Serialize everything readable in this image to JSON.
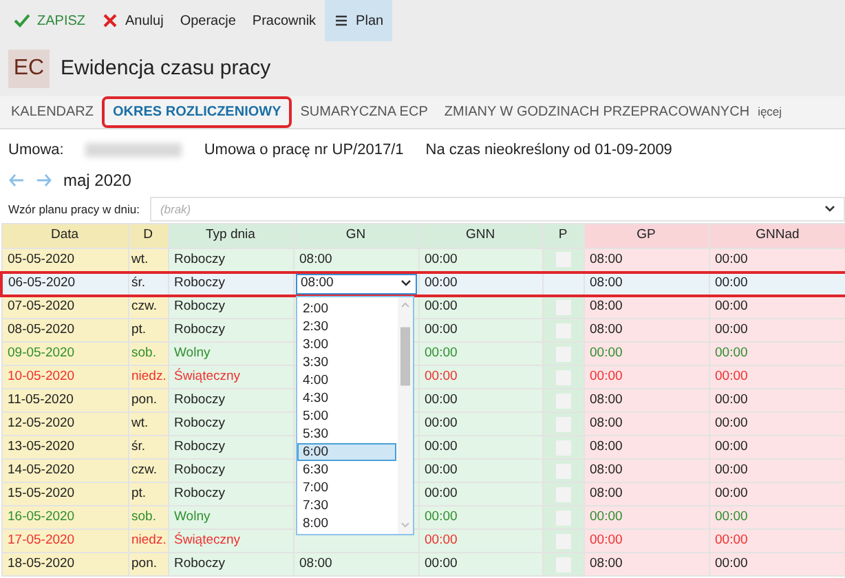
{
  "toolbar": [
    {
      "kind": "check",
      "label": "ZAPISZ",
      "selected": false
    },
    {
      "kind": "cross",
      "label": "Anuluj",
      "selected": false
    },
    {
      "kind": "text",
      "label": "Operacje",
      "selected": false
    },
    {
      "kind": "text",
      "label": "Pracownik",
      "selected": false
    },
    {
      "kind": "menu",
      "label": "Plan",
      "selected": true
    }
  ],
  "header": {
    "badge": "EC",
    "title": "Ewidencja czasu pracy"
  },
  "tabs": [
    {
      "label": "KALENDARZ",
      "selected": false
    },
    {
      "label": "OKRES ROZLICZENIOWY",
      "selected": true
    },
    {
      "label": "SUMARYCZNA ECP",
      "selected": false
    },
    {
      "label": "ZMIANY W GODZINACH PRZEPRACOWANYCH",
      "selected": false
    }
  ],
  "more_tabs": "ięcej",
  "contract": {
    "label": "Umowa:",
    "type": "Umowa o pracę nr UP/2017/1",
    "period": "Na czas nieokreślony od 01-09-2009"
  },
  "month": "maj 2020",
  "plan_pattern": {
    "label": "Wzór planu pracy w dniu:",
    "placeholder": "(brak)"
  },
  "table": {
    "columns": [
      "Data",
      "D",
      "Typ dnia",
      "GN",
      "GNN",
      "P",
      "GP",
      "GNNad"
    ],
    "rows": [
      {
        "date": "05-05-2020",
        "day": "wt.",
        "type": "Roboczy",
        "kind": "work",
        "gn": "08:00",
        "gnn": "00:00",
        "p_checked": false,
        "gp": "08:00",
        "gnnad": "00:00",
        "selected": false
      },
      {
        "date": "06-05-2020",
        "day": "śr.",
        "type": "Roboczy",
        "kind": "work",
        "gn": "08:00",
        "gnn": "00:00",
        "gp": "08:00",
        "gnnad": "00:00",
        "selected": true
      },
      {
        "date": "07-05-2020",
        "day": "czw.",
        "type": "Roboczy",
        "kind": "work",
        "gnn": "00:00",
        "p_checked": false,
        "gp": "08:00",
        "gnnad": "00:00",
        "selected": false
      },
      {
        "date": "08-05-2020",
        "day": "pt.",
        "type": "Roboczy",
        "kind": "work",
        "gnn": "00:00",
        "p_checked": false,
        "gp": "08:00",
        "gnnad": "00:00",
        "selected": false
      },
      {
        "date": "09-05-2020",
        "day": "sob.",
        "type": "Wolny",
        "kind": "free",
        "gnn": "00:00",
        "p_checked": false,
        "gp": "00:00",
        "gnnad": "00:00",
        "selected": false
      },
      {
        "date": "10-05-2020",
        "day": "niedz.",
        "type": "Świąteczny",
        "kind": "holiday",
        "gnn": "00:00",
        "p_checked": false,
        "gp": "00:00",
        "gnnad": "00:00",
        "selected": false
      },
      {
        "date": "11-05-2020",
        "day": "pon.",
        "type": "Roboczy",
        "kind": "work",
        "gnn": "00:00",
        "p_checked": false,
        "gp": "08:00",
        "gnnad": "00:00",
        "selected": false
      },
      {
        "date": "12-05-2020",
        "day": "wt.",
        "type": "Roboczy",
        "kind": "work",
        "gnn": "00:00",
        "p_checked": false,
        "gp": "08:00",
        "gnnad": "00:00",
        "selected": false
      },
      {
        "date": "13-05-2020",
        "day": "śr.",
        "type": "Roboczy",
        "kind": "work",
        "gnn": "00:00",
        "p_checked": false,
        "gp": "08:00",
        "gnnad": "00:00",
        "selected": false
      },
      {
        "date": "14-05-2020",
        "day": "czw.",
        "type": "Roboczy",
        "kind": "work",
        "gnn": "00:00",
        "p_checked": false,
        "gp": "08:00",
        "gnnad": "00:00",
        "selected": false
      },
      {
        "date": "15-05-2020",
        "day": "pt.",
        "type": "Roboczy",
        "kind": "work",
        "gnn": "00:00",
        "p_checked": false,
        "gp": "08:00",
        "gnnad": "00:00",
        "selected": false
      },
      {
        "date": "16-05-2020",
        "day": "sob.",
        "type": "Wolny",
        "kind": "free",
        "gnn": "00:00",
        "p_checked": false,
        "gp": "00:00",
        "gnnad": "00:00",
        "selected": false
      },
      {
        "date": "17-05-2020",
        "day": "niedz.",
        "type": "Świąteczny",
        "kind": "holiday",
        "gnn": "00:00",
        "p_checked": false,
        "gp": "00:00",
        "gnnad": "00:00",
        "selected": false
      },
      {
        "date": "18-05-2020",
        "day": "pon.",
        "type": "Roboczy",
        "kind": "work",
        "gn": "08:00",
        "gnn": "00:00",
        "p_checked": false,
        "gp": "08:00",
        "gnnad": "00:00",
        "selected": false
      }
    ]
  },
  "gn_dropdown": {
    "options": [
      {
        "label": "2:00",
        "selected": false
      },
      {
        "label": "2:30",
        "selected": false
      },
      {
        "label": "3:00",
        "selected": false
      },
      {
        "label": "3:30",
        "selected": false
      },
      {
        "label": "4:00",
        "selected": false
      },
      {
        "label": "4:30",
        "selected": false
      },
      {
        "label": "5:00",
        "selected": false
      },
      {
        "label": "5:30",
        "selected": false
      },
      {
        "label": "6:00",
        "selected": true
      },
      {
        "label": "6:30",
        "selected": false
      },
      {
        "label": "7:00",
        "selected": false
      },
      {
        "label": "7:30",
        "selected": false
      },
      {
        "label": "8:00",
        "selected": false
      }
    ]
  }
}
